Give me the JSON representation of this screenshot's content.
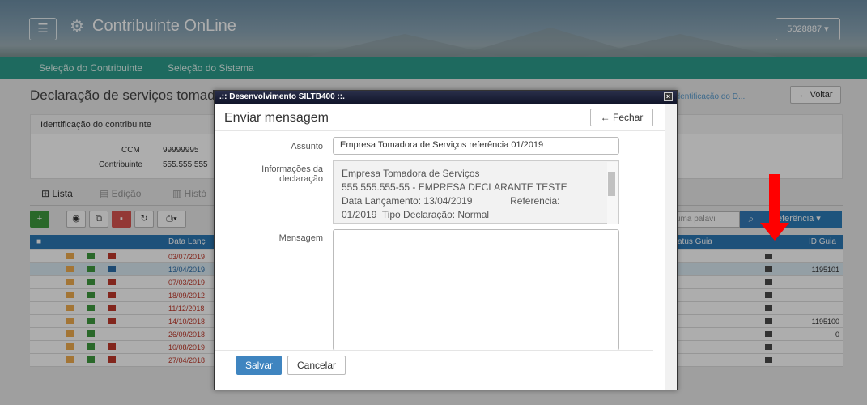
{
  "header": {
    "app_title": "Contribuinte OnLine",
    "user_badge": "5028887 ▾",
    "menu_icon": "hamburger-icon",
    "gear_icon": "gear-icon"
  },
  "nav": {
    "items": [
      {
        "label": "Seleção do Contribuinte"
      },
      {
        "label": "Seleção do Sistema"
      }
    ]
  },
  "page": {
    "title": "Declaração de serviços tomado",
    "breadcrumb": "o / Identificação do D...",
    "back_label": "← Voltar",
    "panel_title": "Identificação do contribuinte",
    "ccm_label": "CCM",
    "ccm_value": "99999995",
    "contribuinte_label": "Contribuinte",
    "contribuinte_value": "555.555.555",
    "tabs": [
      {
        "label": "Lista"
      },
      {
        "label": "Edição"
      },
      {
        "label": "Histó"
      }
    ],
    "search_placeholder": "uma palavı",
    "reference_button": "eferência ▾",
    "table_headers": {
      "date": "Data Lanç",
      "status": "atus Guia",
      "guide_id": "ID Guia"
    },
    "rows": [
      {
        "date": "03/07/2019",
        "id": ""
      },
      {
        "date": "13/04/2019",
        "id": "1195101"
      },
      {
        "date": "07/03/2019",
        "id": ""
      },
      {
        "date": "18/09/2012",
        "id": ""
      },
      {
        "date": "11/12/2018",
        "id": ""
      },
      {
        "date": "14/10/2018",
        "id": "1195100"
      },
      {
        "date": "26/09/2018",
        "id": "0"
      },
      {
        "date": "10/08/2019",
        "id": ""
      },
      {
        "date": "27/04/2018",
        "id": ""
      }
    ]
  },
  "dialog": {
    "window_title": ".:: Desenvolvimento SILTB400 ::.",
    "heading": "Enviar mensagem",
    "close_label": "← Fechar",
    "assunto_label": "Assunto",
    "assunto_value": "Empresa Tomadora de Serviços referência 01/2019",
    "info_label_1": "Informações da",
    "info_label_2": "declaração",
    "info_lines": [
      "Empresa Tomadora de Serviços",
      "555.555.555-55 - EMPRESA DECLARANTE TESTE",
      "Data Lançamento: 13/04/2019              Referencia:",
      "01/2019  Tipo Declaração: Normal"
    ],
    "mensagem_label": "Mensagem",
    "mensagem_value": "",
    "save_label": "Salvar",
    "cancel_label": "Cancelar"
  },
  "colors": {
    "nav": "#2d9c8c",
    "primary": "#337ab7",
    "annotation": "#ff0000"
  }
}
